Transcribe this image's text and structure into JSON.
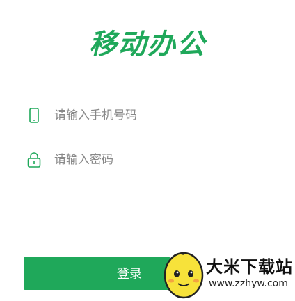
{
  "app": {
    "title": "移动办公"
  },
  "form": {
    "phone_placeholder": "请输入手机号码",
    "phone_icon": "phone-icon",
    "password_placeholder": "请输入密码",
    "password_icon": "lock-icon",
    "login_label": "登录"
  },
  "watermark": {
    "title": "大米下载站",
    "url": "www.zzhyw.com"
  },
  "colors": {
    "brand": "#1fa85a",
    "icon": "#1fa85a",
    "text_muted": "#888888"
  }
}
